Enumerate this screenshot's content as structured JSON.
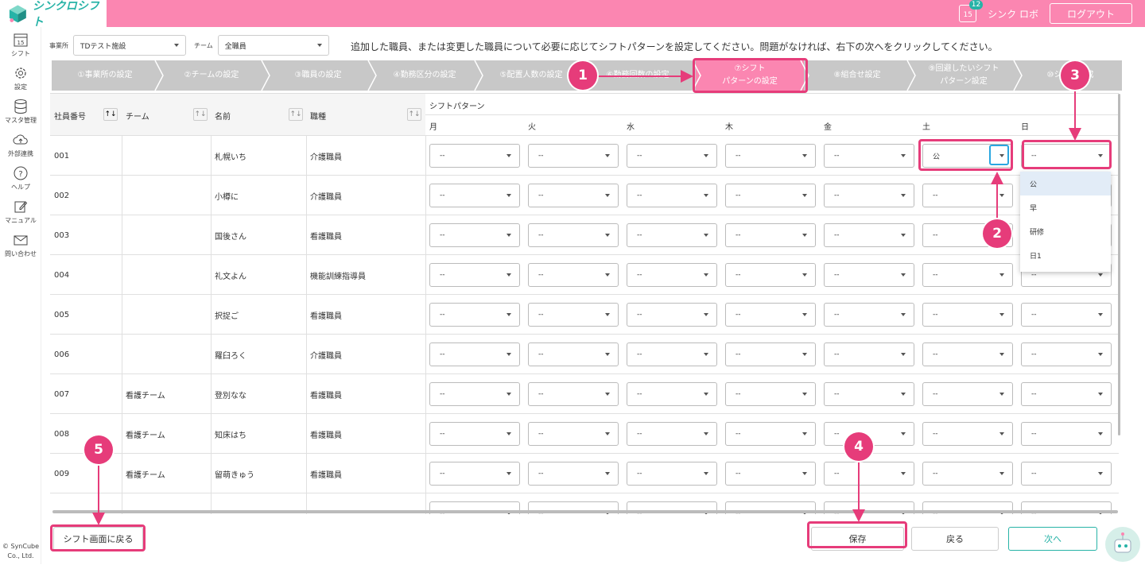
{
  "header": {
    "app_name": "シンクロシフト",
    "calendar_day": "15",
    "notification_count": "12",
    "user_name": "シンク ロボ",
    "logout_label": "ログアウト"
  },
  "sidebar": {
    "items": [
      {
        "label": "シフト",
        "icon": "calendar-icon",
        "day": "15"
      },
      {
        "label": "設定",
        "icon": "gear-icon"
      },
      {
        "label": "マスタ管理",
        "icon": "database-icon"
      },
      {
        "label": "外部連携",
        "icon": "cloud-icon"
      },
      {
        "label": "ヘルプ",
        "icon": "help-icon"
      },
      {
        "label": "マニュアル",
        "icon": "edit-icon"
      },
      {
        "label": "問い合わせ",
        "icon": "mail-icon"
      }
    ],
    "copyright_line1": "© SynCube",
    "copyright_line2": "Co., Ltd."
  },
  "filters": {
    "office_label": "事業所",
    "office_value": "TDテスト施設",
    "team_label": "チーム",
    "team_value": "全職員"
  },
  "instruction": "追加した職員、または変更した職員について必要に応じてシフトパターンを設定してください。問題がなければ、右下の次へをクリックしてください。",
  "steps": [
    "①事業所の設定",
    "②チームの設定",
    "③職員の設定",
    "④勤務区分の設定",
    "⑤配置人数の設定",
    "⑥勤務回数の設定",
    "⑦シフト",
    "パターンの設定",
    "⑧組合せ設定",
    "⑨回避したいシフト",
    "パターン設定",
    "⑩シフト作成"
  ],
  "table": {
    "headers": {
      "employee_no": "社員番号",
      "team": "チーム",
      "name": "名前",
      "job": "職種",
      "shift_pattern": "シフトパターン",
      "sort_icon": "↑↓"
    },
    "days": [
      "月",
      "火",
      "水",
      "木",
      "金",
      "土",
      "日"
    ],
    "default_value": "--",
    "rows": [
      {
        "no": "001",
        "team": "",
        "name": "札幌いち",
        "job": "介護職員",
        "sat": "公",
        "sun": "--"
      },
      {
        "no": "002",
        "team": "",
        "name": "小樽に",
        "job": "介護職員"
      },
      {
        "no": "003",
        "team": "",
        "name": "国後さん",
        "job": "看護職員"
      },
      {
        "no": "004",
        "team": "",
        "name": "礼文よん",
        "job": "機能訓練指導員"
      },
      {
        "no": "005",
        "team": "",
        "name": "択捉ご",
        "job": "看護職員"
      },
      {
        "no": "006",
        "team": "",
        "name": "羅臼ろく",
        "job": "介護職員"
      },
      {
        "no": "007",
        "team": "看護チーム",
        "name": "登別なな",
        "job": "看護職員"
      },
      {
        "no": "008",
        "team": "看護チーム",
        "name": "知床はち",
        "job": "看護職員"
      },
      {
        "no": "009",
        "team": "看護チーム",
        "name": "留萌きゅう",
        "job": "看護職員"
      }
    ],
    "dropdown_options": [
      "公",
      "早",
      "研修",
      "日1"
    ]
  },
  "footer": {
    "back_to_shift": "シフト画面に戻る",
    "save": "保存",
    "back": "戻る",
    "next": "次へ"
  },
  "annotations": [
    "1",
    "2",
    "3",
    "4",
    "5"
  ],
  "colors": {
    "brand_pink": "#fb86b1",
    "annotation_pink": "#e63c7a",
    "teal": "#27b3a7",
    "step_grey": "#c8c8c8"
  }
}
